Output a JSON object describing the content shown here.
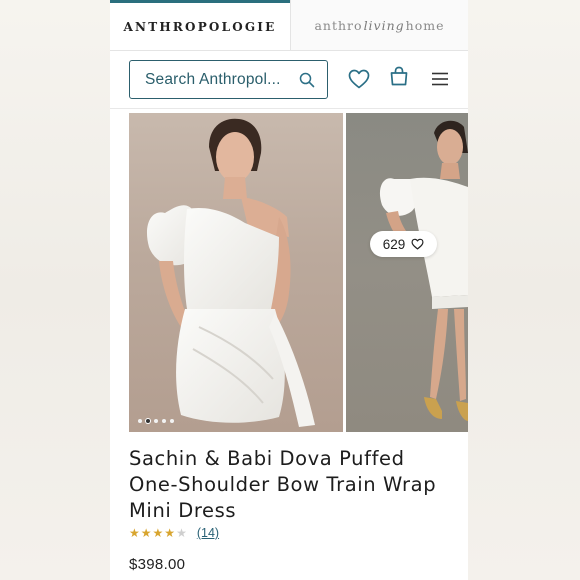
{
  "brands": {
    "main": "ANTHROPOLOGIE",
    "home_prefix": "anthro",
    "home_script": "living",
    "home_suffix": "home"
  },
  "search": {
    "placeholder": "Search Anthropol..."
  },
  "header_icons": [
    "search-icon",
    "heart-icon",
    "shopping-bag-icon",
    "menu-icon"
  ],
  "gallery": {
    "like_count": "629",
    "dot_count": 5,
    "active_dot": 2
  },
  "product": {
    "title": "Sachin & Babi Dova Puffed One-Shoulder Bow Train Wrap Mini Dress",
    "rating": 4,
    "rating_max": 5,
    "review_count": "(14)",
    "price": "$398.00"
  },
  "colors": {
    "accent": "#2a6f7e",
    "star": "#d8a52f",
    "link": "#2a6276"
  }
}
